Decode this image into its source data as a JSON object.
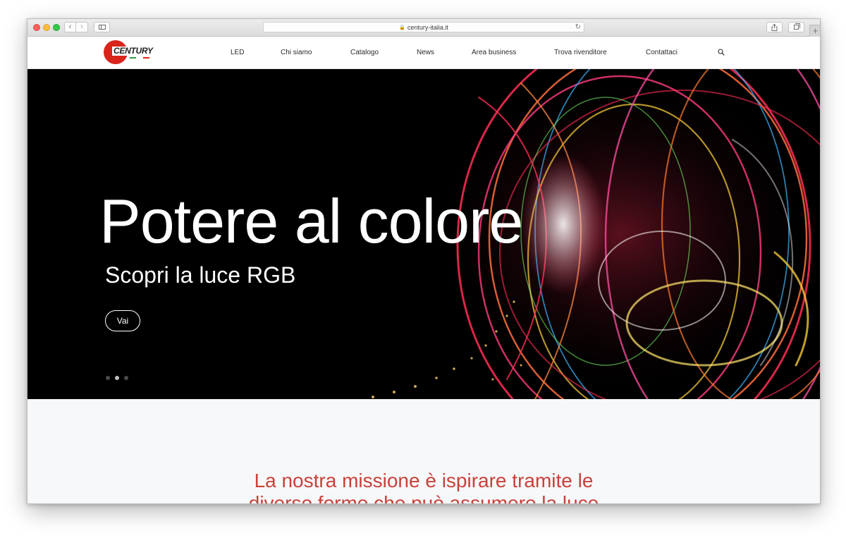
{
  "browser": {
    "url": "century-italia.it",
    "back_icon": "‹",
    "forward_icon": "›",
    "reload_icon": "↻",
    "lock_icon": "🔒",
    "newtab_icon": "+"
  },
  "logo": {
    "text": "CENTURY",
    "colors": {
      "circle": "#d9241c",
      "flag": [
        "#2e9b45",
        "#ffffff",
        "#d9241c"
      ]
    }
  },
  "nav": {
    "items": [
      {
        "label": "LED"
      },
      {
        "label": "Chi siamo"
      },
      {
        "label": "Catalogo"
      },
      {
        "label": "News"
      },
      {
        "label": "Area business"
      },
      {
        "label": "Trova rivenditore"
      },
      {
        "label": "Contattaci"
      }
    ]
  },
  "hero": {
    "title": "Potere al colore",
    "subtitle": "Scopri la luce RGB",
    "button_label": "Vai",
    "slides_total": 3,
    "slide_active": 2
  },
  "mission": {
    "text_line1": "La nostra missione è ispirare tramite le",
    "text_line2": "diverse forme che può assumere la luce"
  },
  "colors": {
    "accent": "#c9413a",
    "hero_bg": "#000000",
    "mission_bg": "#f7f8fa"
  }
}
